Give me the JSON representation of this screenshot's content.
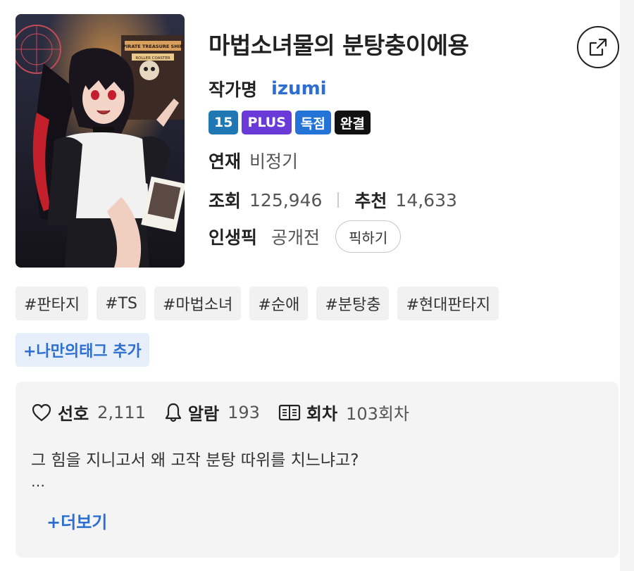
{
  "work": {
    "title": "마법소녀물의 분탕충이에용",
    "author_label": "작가명",
    "author": "izumi",
    "badges": [
      {
        "text": "15",
        "color": "#1f78b4"
      },
      {
        "text": "PLUS",
        "color": "#6a3ad9"
      },
      {
        "text": "독점",
        "color": "#2473d6"
      },
      {
        "text": "완결",
        "color": "#111111"
      }
    ],
    "serial_label": "연재",
    "serial_value": "비정기",
    "views_label": "조회",
    "views_value": "125,946",
    "recommend_label": "추천",
    "recommend_value": "14,633",
    "pick_label": "인생픽",
    "pick_value": "공개전",
    "pick_button": "픽하기"
  },
  "cover_text": {
    "sign_top": "PIRATE TREASURE SHIP",
    "sign_bottom": "ROLLER COASTER"
  },
  "tags": [
    "#판타지",
    "#TS",
    "#마법소녀",
    "#순애",
    "#분탕충",
    "#현대판타지"
  ],
  "add_tag_label": "+나만의태그 추가",
  "stats": {
    "like_label": "선호",
    "like_value": "2,111",
    "alarm_label": "알람",
    "alarm_value": "193",
    "episodes_label": "회차",
    "episodes_value": "103회차"
  },
  "synopsis": {
    "text": "그 힘을 지니고서 왜 고작 분탕 따위를 치느냐고?",
    "ellipsis": "…",
    "more_label": "+더보기"
  },
  "icons": {
    "share": "share-icon",
    "like": "heart-icon",
    "alarm": "bell-icon",
    "episodes": "book-icon"
  },
  "colors": {
    "accent": "#2c6fd1",
    "tag_bg": "#f1f1f2",
    "card_bg": "#f4f4f5"
  }
}
